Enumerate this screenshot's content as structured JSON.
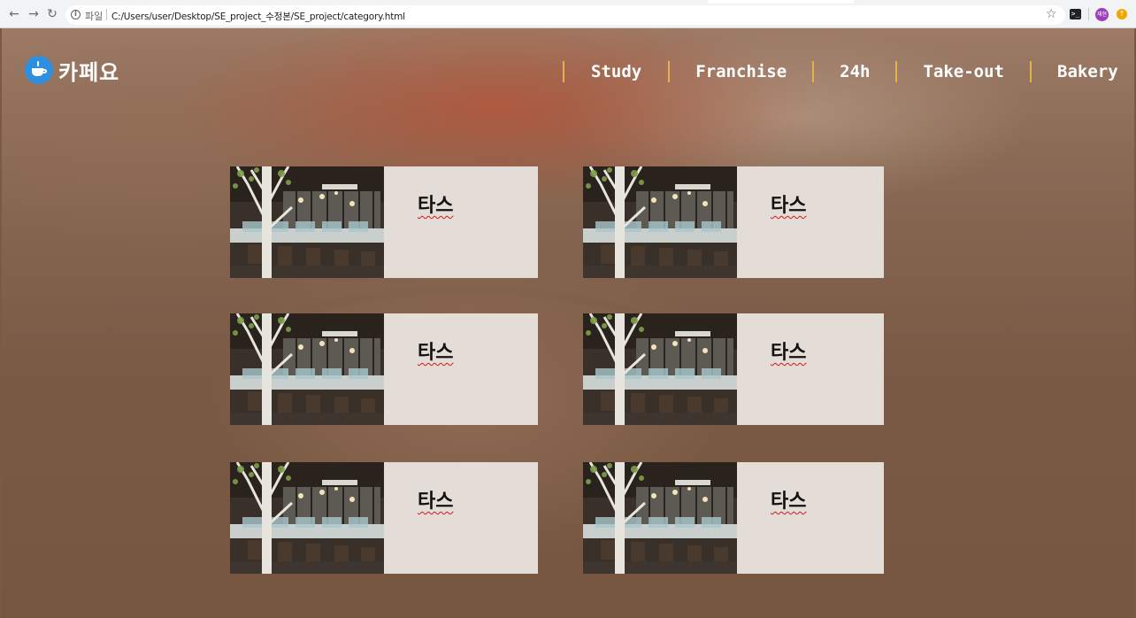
{
  "browser": {
    "file_label": "파일",
    "url": "C:/Users/user/Desktop/SE_project_수정본/SE_project/category.html",
    "profile_initial": "재현"
  },
  "header": {
    "logo_text": "카페요",
    "nav": [
      "Study",
      "Franchise",
      "24h",
      "Take-out",
      "Bakery"
    ]
  },
  "cafes": [
    {
      "name": "타스"
    },
    {
      "name": "타스"
    },
    {
      "name": "타스"
    },
    {
      "name": "타스"
    },
    {
      "name": "타스"
    },
    {
      "name": "타스"
    }
  ],
  "colors": {
    "nav_divider": "#e8b04a",
    "card_bg": "#e3dcd7",
    "logo_circle": "#2e8fe0"
  }
}
